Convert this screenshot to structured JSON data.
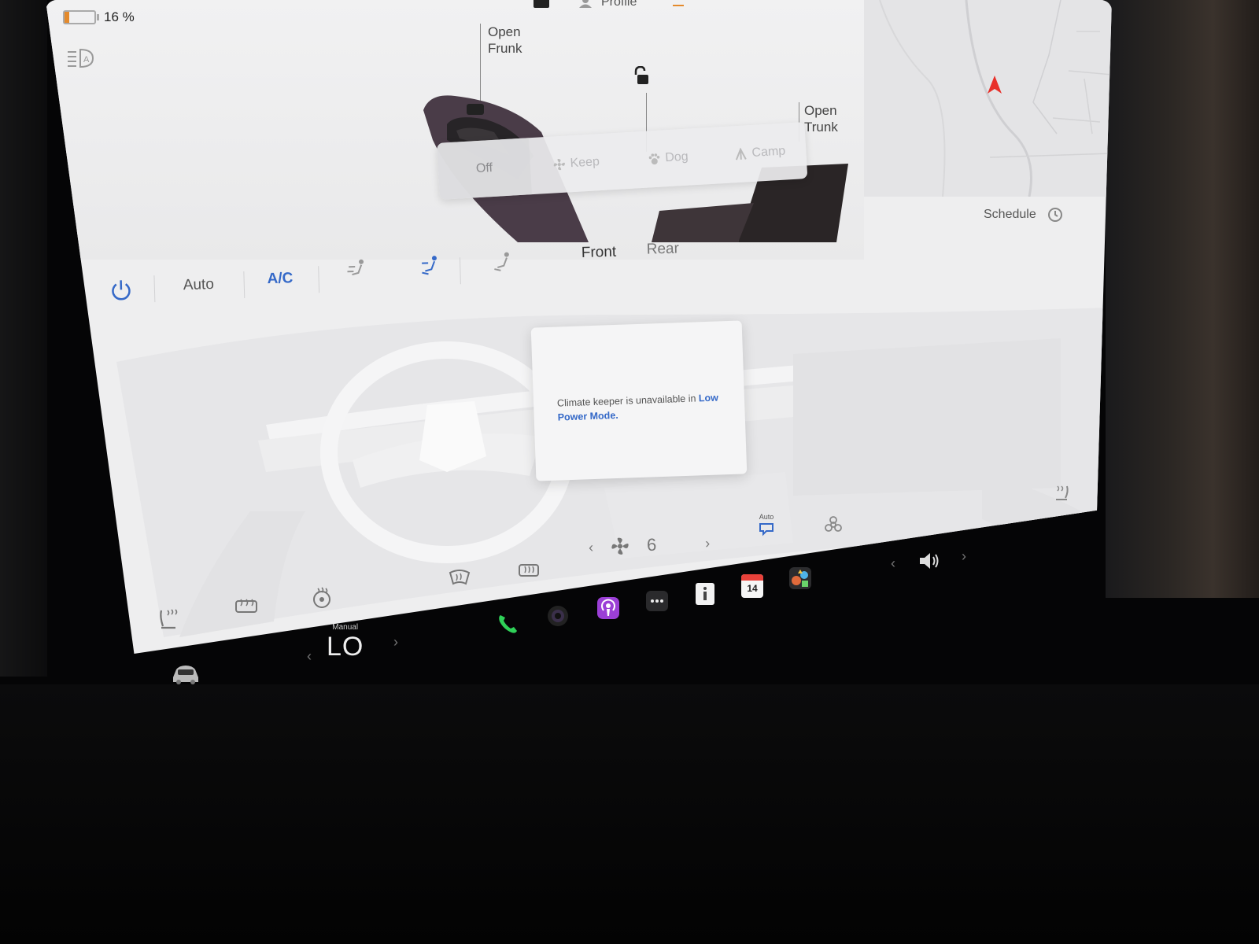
{
  "status": {
    "battery_percent": "16 %",
    "battery_level": 0.16,
    "battery_color": "#e48a2c"
  },
  "header": {
    "profile_label": "Profile"
  },
  "car": {
    "frunk_label": "Open\nFrunk",
    "trunk_label": "Open\nTrunk",
    "frunk_line1": "Open",
    "frunk_line2": "Frunk",
    "trunk_line1": "Open",
    "trunk_line2": "Trunk"
  },
  "climate_modes": [
    {
      "label": "Off",
      "icon": "none",
      "active": true
    },
    {
      "label": "Keep",
      "icon": "fan-icon",
      "active": false
    },
    {
      "label": "Dog",
      "icon": "paw-icon",
      "active": false
    },
    {
      "label": "Camp",
      "icon": "tent-icon",
      "active": false
    }
  ],
  "schedule": {
    "label": "Schedule",
    "icon": "clock-icon"
  },
  "climate_bar": {
    "power_icon": "power-icon",
    "auto_label": "Auto",
    "ac_label": "A/C",
    "front_label": "Front",
    "rear_label": "Rear"
  },
  "popup": {
    "message": "Climate keeper is unavailable in",
    "link_text": "Low Power Mode."
  },
  "fan": {
    "speed": "6",
    "icon": "fan-icon"
  },
  "recirculation": {
    "label": "Auto",
    "icon": "recirculate-icon"
  },
  "temperature": {
    "mode": "Manual",
    "value": "LO"
  },
  "dock": {
    "calendar_day": "14",
    "icons": [
      "car-icon",
      "phone-icon",
      "camera-icon",
      "podcasts-icon",
      "more-icon",
      "manual-icon",
      "calendar-icon",
      "games-icon",
      "volume-icon"
    ]
  },
  "colors": {
    "accent_blue": "#3569c8",
    "phone_green": "#2fd158",
    "podcast_purple": "#9b3fd6",
    "calendar_red": "#e8413a",
    "nav_red": "#e8302a"
  }
}
